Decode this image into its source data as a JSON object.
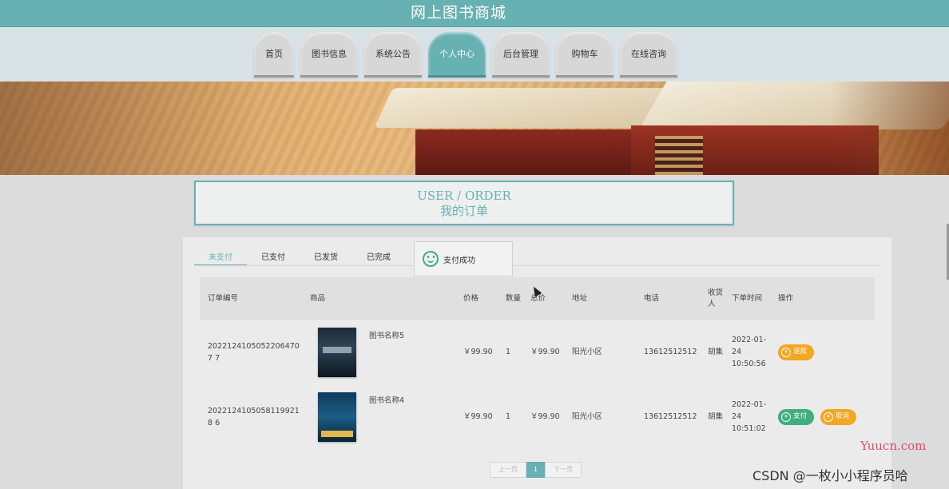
{
  "site": {
    "title": "网上图书商城"
  },
  "nav": [
    {
      "label": "首页",
      "active": false
    },
    {
      "label": "图书信息",
      "active": false
    },
    {
      "label": "系统公告",
      "active": false
    },
    {
      "label": "个人中心",
      "active": true
    },
    {
      "label": "后台管理",
      "active": false
    },
    {
      "label": "购物车",
      "active": false
    },
    {
      "label": "在线咨询",
      "active": false
    }
  ],
  "heading": {
    "en": "USER / ORDER",
    "cn": "我的订单"
  },
  "tabs": [
    {
      "label": "未支付",
      "active": true
    },
    {
      "label": "已支付",
      "active": false
    },
    {
      "label": "已发货",
      "active": false
    },
    {
      "label": "已完成",
      "active": false
    }
  ],
  "toast": {
    "icon": "smile-icon",
    "text": "支付成功"
  },
  "table": {
    "headers": [
      "订单编号",
      "商品",
      "价格",
      "数量",
      "总价",
      "地址",
      "电话",
      "收货人",
      "下单时间",
      "操作"
    ],
    "rows": [
      {
        "order_no": "20221241050522064707 7",
        "product": "图书名称5",
        "price": "￥99.90",
        "qty": "1",
        "total": "￥99.90",
        "address": "阳光小区",
        "phone": "13612512512",
        "receiver": "胡集",
        "time": "2022-01-24 10:50:56",
        "actions": [
          {
            "label": "退款",
            "color": "#f5a623"
          }
        ]
      },
      {
        "order_no": "20221241050581199218 6",
        "product": "图书名称4",
        "price": "￥99.90",
        "qty": "1",
        "total": "￥99.90",
        "address": "阳光小区",
        "phone": "13612512512",
        "receiver": "胡集",
        "time": "2022-01-24 10:51:02",
        "actions": [
          {
            "label": "支付",
            "color": "#3fae80"
          },
          {
            "label": "取消",
            "color": "#f5a623"
          }
        ]
      }
    ]
  },
  "pager": {
    "prev": "上一页",
    "current": "1",
    "next": "下一页"
  },
  "watermarks": {
    "yuucn": "Yuucn.com",
    "csdn": "CSDN @一枚小小程序员哈"
  },
  "colors": {
    "theme": "#67b1b3",
    "orange": "#f5a623",
    "green": "#3fae80"
  }
}
